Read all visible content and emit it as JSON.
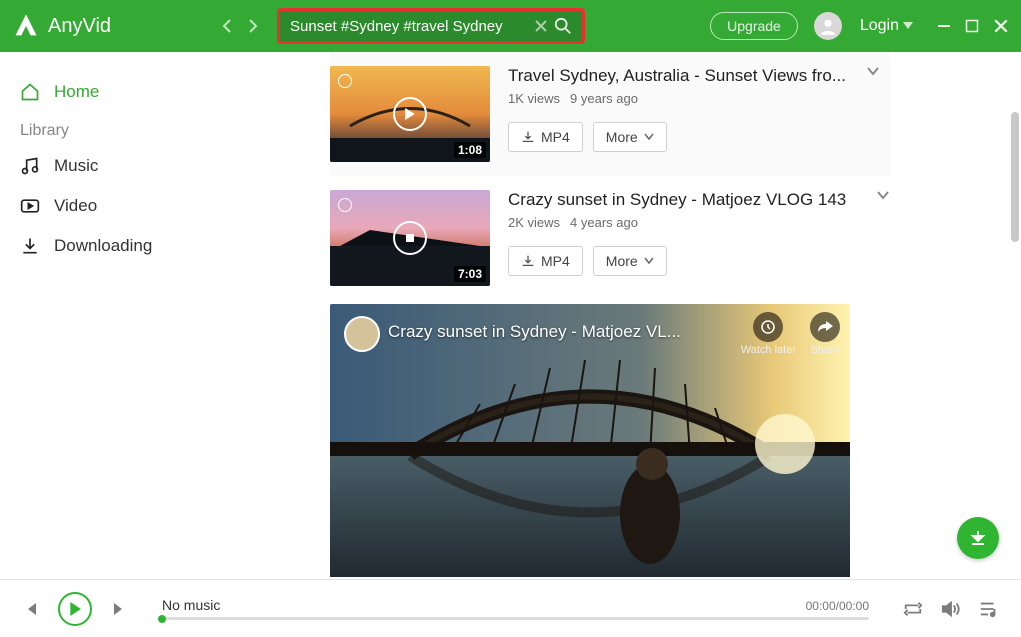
{
  "header": {
    "app_name": "AnyVid",
    "search_value": "Sunset #Sydney #travel Sydney",
    "upgrade_label": "Upgrade",
    "login_label": "Login"
  },
  "sidebar": {
    "home_label": "Home",
    "library_header": "Library",
    "music_label": "Music",
    "video_label": "Video",
    "downloading_label": "Downloading"
  },
  "results": [
    {
      "title": "Travel Sydney, Australia - Sunset Views fro...",
      "views": "1K views",
      "age": "9 years ago",
      "duration": "1:08",
      "format_label": "MP4",
      "more_label": "More"
    },
    {
      "title": "Crazy sunset in Sydney - Matjoez VLOG 143",
      "views": "2K views",
      "age": "4 years ago",
      "duration": "7:03",
      "format_label": "MP4",
      "more_label": "More"
    }
  ],
  "player": {
    "title": "Crazy sunset in Sydney - Matjoez VL...",
    "watch_later": "Watch later",
    "share": "Share"
  },
  "footer": {
    "track_label": "No music",
    "time_display": "00:00/00:00"
  }
}
